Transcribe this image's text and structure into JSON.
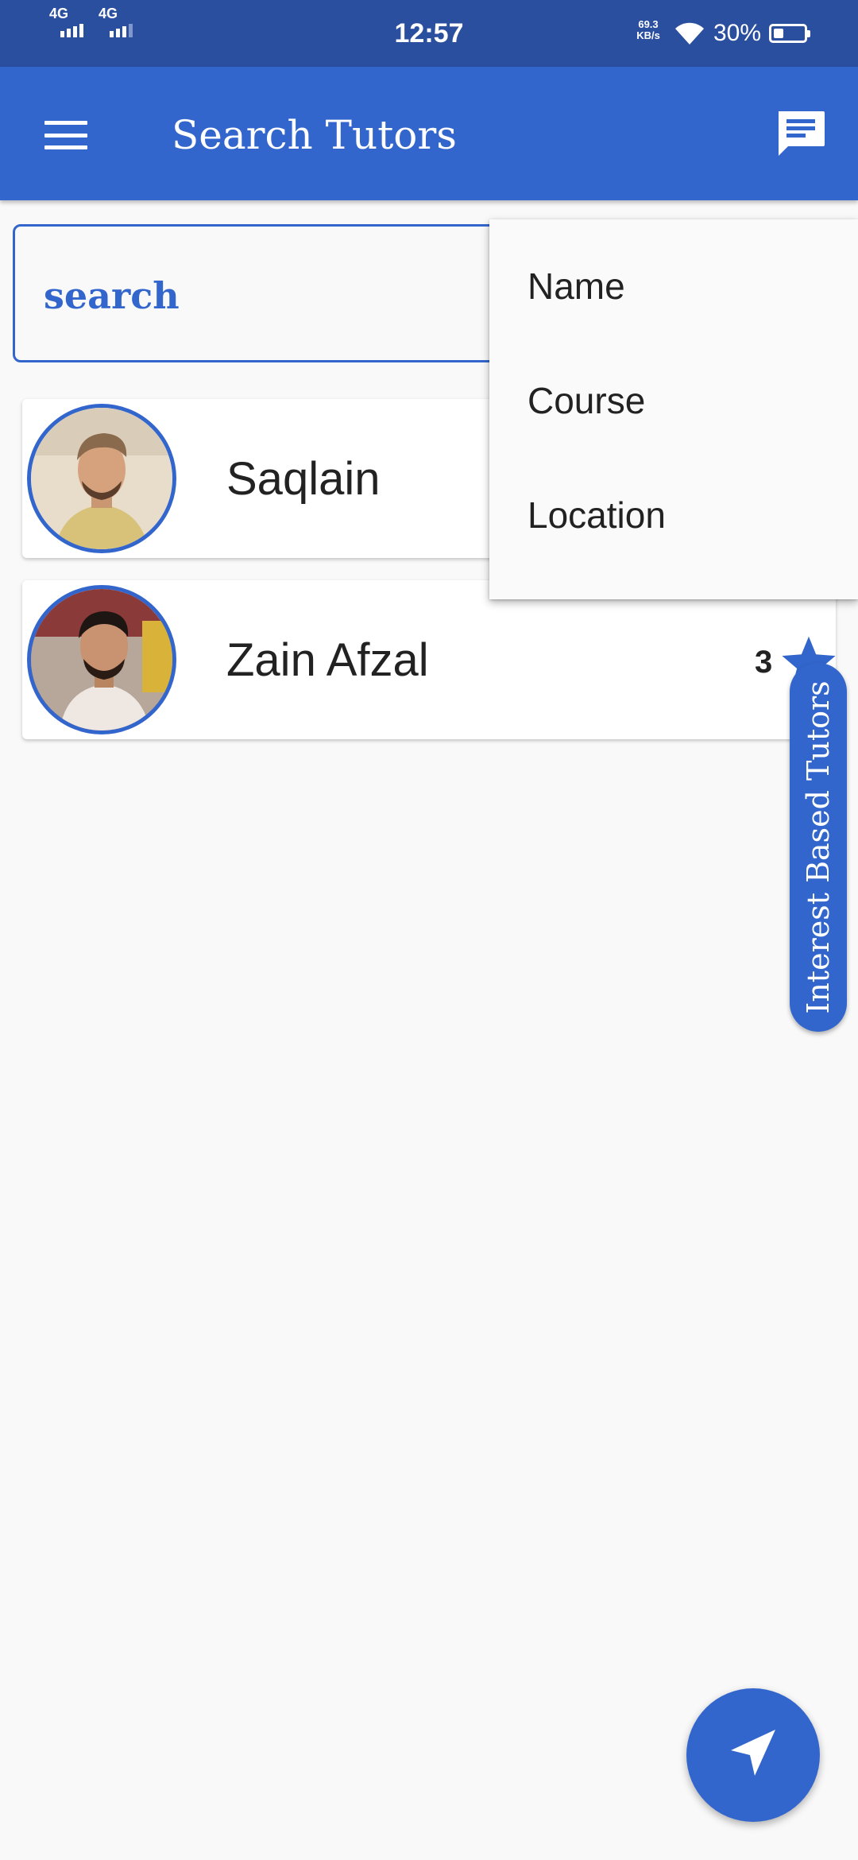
{
  "status_bar": {
    "network_1": "4G",
    "network_2": "4G",
    "time": "12:57",
    "speed_value": "69.3",
    "speed_unit": "KB/s",
    "battery": "30%"
  },
  "app_bar": {
    "title": "Search Tutors",
    "menu_icon": "hamburger-menu-icon",
    "action_icon": "chat-message-icon"
  },
  "search": {
    "placeholder": "search"
  },
  "tutors": [
    {
      "name": "Saqlain"
    },
    {
      "name": "Zain Afzal",
      "rating": "3"
    }
  ],
  "filter_menu": {
    "items": [
      "Name",
      "Course",
      "Location"
    ]
  },
  "side_tab": {
    "label": "Interest Based Tutors"
  },
  "fab": {
    "icon": "send-location-icon"
  },
  "colors": {
    "primary": "#3366cc",
    "status_bar": "#2a4f9f",
    "background": "#f9f9f9"
  }
}
